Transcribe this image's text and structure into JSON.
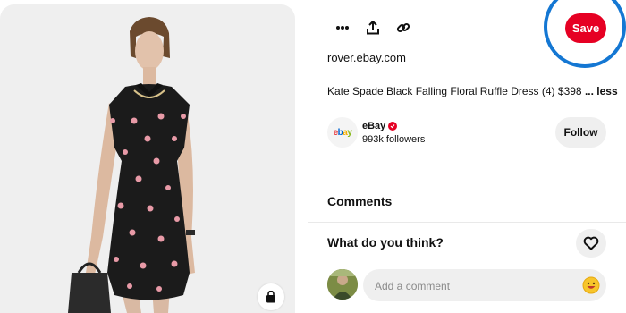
{
  "pin": {
    "image_alt": "Woman wearing a black dress with pink floral print",
    "source_link": "rover.ebay.com",
    "description": "Kate Spade Black Falling Floral Ruffle Dress (4) $398",
    "more_label": "... less"
  },
  "toolbar": {
    "more_icon": "more-horizontal-icon",
    "share_icon": "share-upload-icon",
    "link_icon": "link-icon",
    "save_label": "Save"
  },
  "creator": {
    "logo_letters": [
      "e",
      "b",
      "a",
      "y"
    ],
    "name": "eBay",
    "followers": "993k followers",
    "follow_label": "Follow"
  },
  "comments": {
    "heading": "Comments",
    "prompt": "What do you think?",
    "input_placeholder": "Add a comment"
  },
  "colors": {
    "brand_red": "#e60023",
    "highlight_blue": "#1477d3",
    "panel_gray": "#efefef"
  }
}
